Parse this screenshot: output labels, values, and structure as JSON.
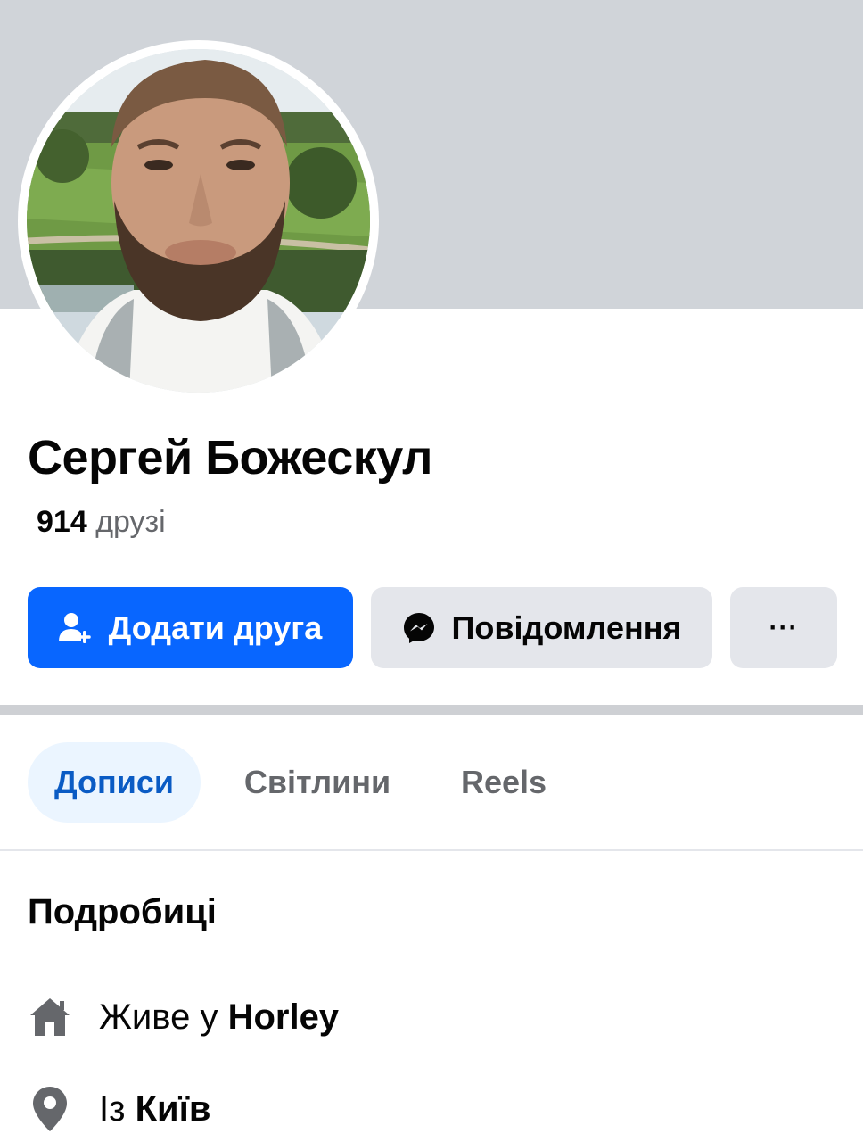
{
  "profile": {
    "name": "Сергей Божескул",
    "friends_count": "914",
    "friends_label": "друзі"
  },
  "actions": {
    "add_friend_label": "Додати друга",
    "message_label": "Повідомлення",
    "more_label": "···"
  },
  "tabs": [
    {
      "label": "Дописи",
      "active": true
    },
    {
      "label": "Світлини",
      "active": false
    },
    {
      "label": "Reels",
      "active": false
    }
  ],
  "details": {
    "title": "Подробиці",
    "items": [
      {
        "icon": "home-icon",
        "prefix": "Живе у",
        "value": "Horley"
      },
      {
        "icon": "location-pin-icon",
        "prefix": "Із",
        "value": "Київ"
      }
    ]
  },
  "colors": {
    "accent": "#0866ff",
    "active_tab_bg": "#ebf5ff",
    "active_tab_text": "#0a5bc4",
    "secondary_button": "#e4e6eb",
    "cover": "#d0d4d9"
  }
}
